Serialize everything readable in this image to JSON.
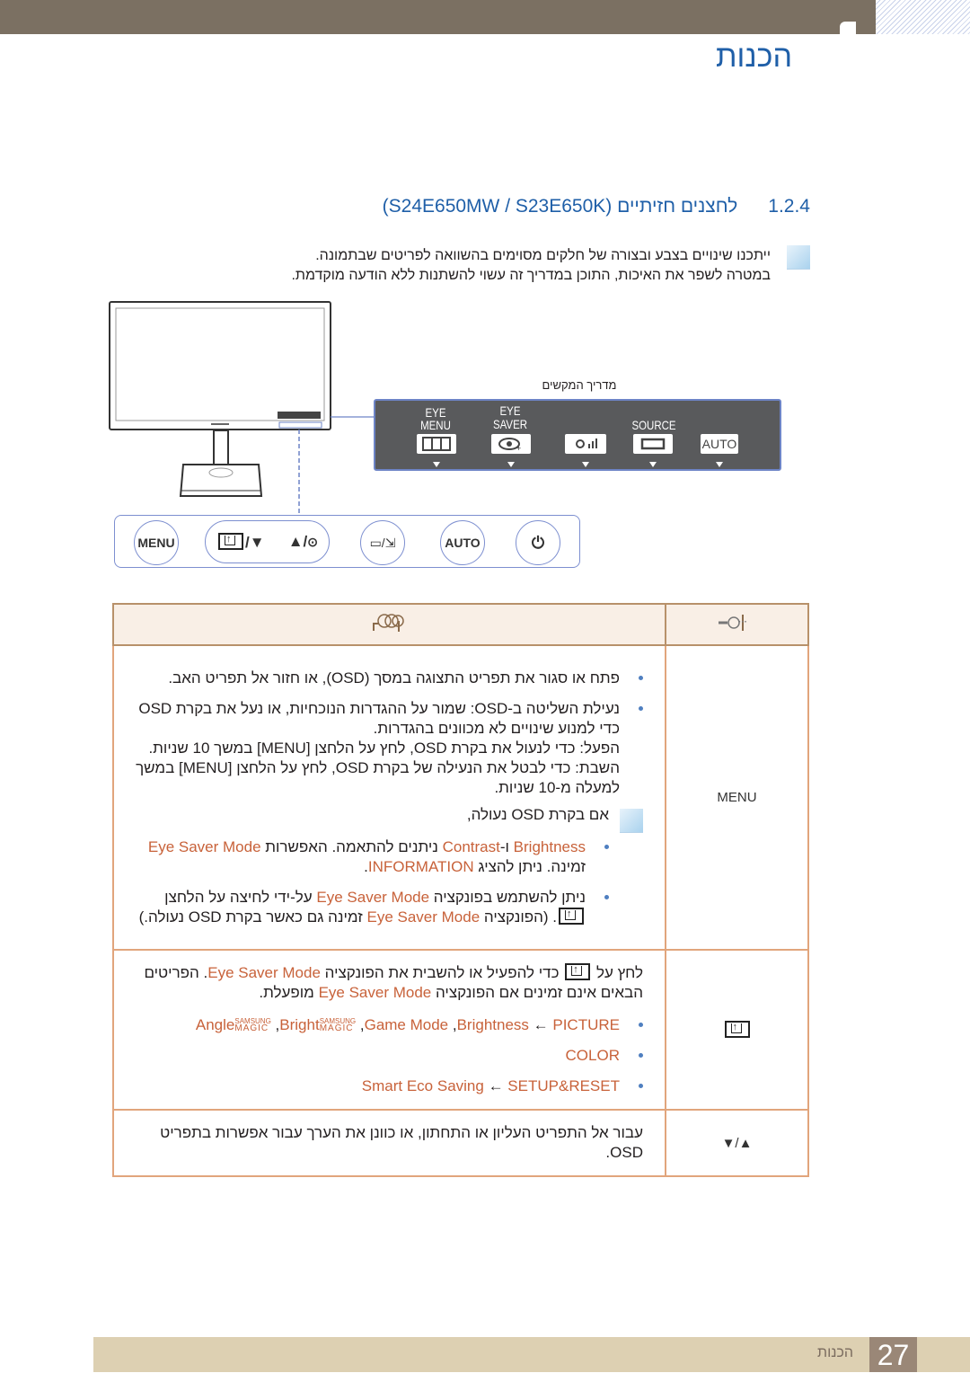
{
  "header": {
    "chapter_title": "הכנות"
  },
  "section": {
    "number": "1.2.4",
    "title": "לחצנים חזיתיים (S24E650MW / S23E650K)"
  },
  "intro": {
    "icon": "note-icon",
    "lines": [
      "ייתכנו שינויים בצבע ובצורה של חלקים מסוימים בהשוואה לפריטים שבתמונה.",
      "במטרה לשפר את האיכות, התוכן במדריך זה עשוי להשתנות ללא הודעה מוקדמת."
    ]
  },
  "diagram": {
    "guide_label": "מדריך המקשים",
    "guide_items": [
      {
        "label_top": "",
        "label": "MENU",
        "box": "menu-icon"
      },
      {
        "label_top": "EYE",
        "label": "SAVER",
        "box": "eye-saver-icon"
      },
      {
        "label_top": "",
        "label": "",
        "box": "brightness-volume-icon"
      },
      {
        "label_top": "",
        "label": "SOURCE",
        "box": "source-icon"
      },
      {
        "label_top": "",
        "label": "",
        "box": "AUTO"
      }
    ],
    "buttons": [
      {
        "label": "MENU"
      },
      {
        "label": "/▼",
        "icon": "eye-saver-icon"
      },
      {
        "label": "▲/",
        "icon": "circle-icon"
      },
      {
        "label": "/",
        "icon": "source-icon"
      },
      {
        "label": "AUTO"
      },
      {
        "label": "",
        "icon": "power-icon"
      }
    ]
  },
  "colors": {
    "accent": "#1f5fa8",
    "highlight": "#c8623a",
    "table_border": "#e1a57c",
    "header_bar": "#7b7062",
    "footer": "#ddd0b2"
  },
  "table": {
    "header_icons": {
      "key": "key-icon",
      "description": "description-icon"
    },
    "rows": [
      {
        "key": "MENU",
        "bullets": [
          [
            {
              "t": "פתח או סגור את תפריט התצוגה במסך (OSD), או חזור אל תפריט האב."
            }
          ],
          [
            {
              "t": "נעילת השליטה ב-OSD: שמור על ההגדרות הנוכחיות, או נעל את בקרת OSD כדי למנוע שינויים לא מכוונים בהגדרות."
            }
          ]
        ],
        "extra_lines": [
          "הפעל: כדי לנעול את בקרת OSD, לחץ על הלחצן [MENU] במשך 10 שניות.",
          "השבת: כדי לבטל את הנעילה של בקרת OSD, לחץ על הלחצן [MENU] במשך למעלה מ-10 שניות."
        ],
        "note": {
          "title": "אם בקרת OSD נעולה,",
          "bullets": [
            [
              {
                "t": "Brightness",
                "hl": true
              },
              {
                "t": " ו-"
              },
              {
                "t": "Contrast",
                "hl": true
              },
              {
                "t": " ניתנים להתאמה. האפשרות "
              },
              {
                "t": "Eye Saver Mode",
                "hl": true
              },
              {
                "t": " זמינה. ניתן להציג "
              },
              {
                "t": "INFORMATION",
                "hl": true
              },
              {
                "t": "."
              }
            ],
            [
              {
                "t": "ניתן להשתמש בפונקציה "
              },
              {
                "t": "Eye Saver Mode",
                "hl": true
              },
              {
                "t": " על-ידי לחיצה על הלחצן "
              },
              {
                "icon": "eye-saver-icon"
              },
              {
                "t": ". (הפונקציה "
              },
              {
                "t": "Eye Saver Mode",
                "hl": true
              },
              {
                "t": " זמינה גם כאשר בקרת OSD נעולה.)"
              }
            ]
          ]
        }
      },
      {
        "key_icon": "eye-saver-icon",
        "text": [
          {
            "t": "לחץ על "
          },
          {
            "icon": "eye-saver-icon"
          },
          {
            "t": " כדי להפעיל או להשבית את הפונקציה "
          },
          {
            "t": "Eye Saver Mode",
            "hl": true
          },
          {
            "t": ". הפריטים הבאים אינם זמינים אם הפונקציה "
          },
          {
            "t": "Eye Saver Mode",
            "hl": true
          },
          {
            "t": " מופעלת."
          }
        ],
        "bullets": [
          [
            {
              "t": "PICTURE",
              "hl": true
            },
            {
              "t": " ← "
            },
            {
              "t": "Brightness",
              "hl": true
            },
            {
              "t": ", "
            },
            {
              "t": "Game Mode",
              "hl": true
            },
            {
              "t": ", "
            },
            {
              "magic": "Bright"
            },
            {
              "t": ", "
            },
            {
              "magic": "Angle"
            }
          ],
          [
            {
              "t": "COLOR",
              "hl": true
            }
          ],
          [
            {
              "t": "SETUP&RESET",
              "hl": true
            },
            {
              "t": " ← "
            },
            {
              "t": "Smart Eco Saving",
              "hl": true
            }
          ]
        ]
      },
      {
        "key": "▲/▼",
        "text": [
          {
            "t": "עבור אל התפריט העליון או התחתון, או כוונן את הערך עבור אפשרות בתפריט OSD."
          }
        ]
      }
    ],
    "magic_top": "SAMSUNG",
    "magic_bottom": "MAGIC"
  },
  "footer": {
    "page_number": "27",
    "label": "הכנות"
  }
}
